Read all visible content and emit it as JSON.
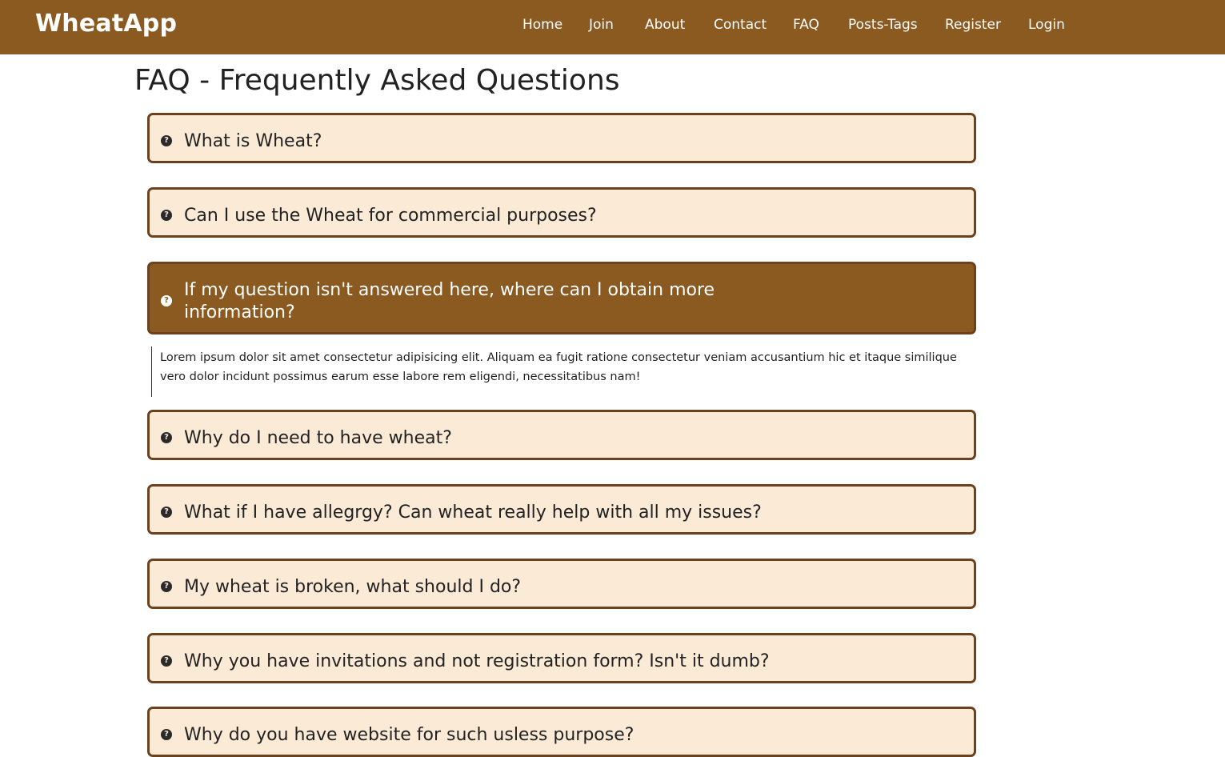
{
  "navbar": {
    "brand": "WheatApp",
    "links": [
      "Home",
      "Join",
      "About",
      "Contact",
      "FAQ",
      "Posts-Tags",
      "Register",
      "Login"
    ]
  },
  "page": {
    "title": "FAQ - Frequently Asked Questions"
  },
  "faq": {
    "items": [
      {
        "question": "What is Wheat?",
        "expanded": false
      },
      {
        "question": "Can I use the Wheat for commercial purposes?",
        "expanded": false
      },
      {
        "question": "If my question isn't answered here, where can I obtain more information?",
        "expanded": true,
        "answer": "Lorem ipsum dolor sit amet consectetur adipisicing elit. Aliquam ea fugit ratione consectetur veniam accusantium hic et itaque similique vero dolor incidunt possimus earum esse labore rem eligendi, necessitatibus nam!"
      },
      {
        "question": "Why do I need to have wheat?",
        "expanded": false
      },
      {
        "question": "What if I have allegrgy? Can wheat really help with all my issues?",
        "expanded": false
      },
      {
        "question": "My wheat is broken, what should I do?",
        "expanded": false
      },
      {
        "question": "Why you have invitations and not registration form? Isn't it dumb?",
        "expanded": false
      },
      {
        "question": "Why do you have website for such usless purpose?",
        "expanded": false
      }
    ]
  },
  "colors": {
    "brand": "#8b5a20",
    "card": "#fbebd6",
    "border": "#6b4220"
  },
  "icons": {
    "faq_item": "question-circle-icon"
  }
}
